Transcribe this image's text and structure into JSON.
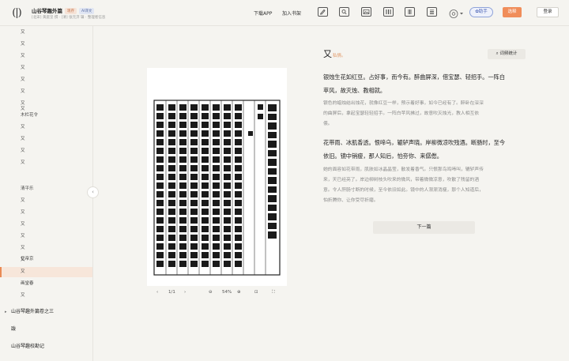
{
  "header": {
    "logo": "(|)",
    "book_title": "山谷琴趣外篇",
    "badge_primary": "现存",
    "badge_secondary": "AI译文",
    "book_meta": "[北宋] 黄庭坚 撰  ·  [清] 张元济 辑  ·  整理者信息",
    "download_app": "下载APP",
    "add_shelf": "加入书架",
    "help_label": "助手",
    "hide_label": "选释",
    "login_label": "登录"
  },
  "sidebar": {
    "items": [
      {
        "label": "又"
      },
      {
        "label": "又"
      },
      {
        "label": "又"
      },
      {
        "label": "又"
      },
      {
        "label": "又"
      },
      {
        "label": "又"
      },
      {
        "label": "又"
      },
      {
        "label": "又"
      },
      {
        "label": "木栏花令"
      },
      {
        "label": "又"
      },
      {
        "label": "又"
      },
      {
        "label": "又"
      },
      {
        "label": "又"
      },
      {
        "label": "清平乐"
      },
      {
        "label": "又"
      },
      {
        "label": "又"
      },
      {
        "label": "又"
      },
      {
        "label": "又"
      },
      {
        "label": "又"
      },
      {
        "label": "又"
      },
      {
        "label": "忆帝京"
      },
      {
        "label": "又"
      },
      {
        "label": "画堂春"
      },
      {
        "label": "又"
      }
    ],
    "sections": [
      {
        "label": "山谷琴趣外篇卷之三"
      },
      {
        "label": "跋"
      },
      {
        "label": "山谷琴趣校勘记"
      }
    ]
  },
  "viewer": {
    "page": "1/1",
    "zoom": "54%"
  },
  "poem": {
    "title": "又",
    "subtitle": "私情。",
    "stats_label": "词频统计",
    "stanzas": [
      {
        "original": [
          "银烛生花如红豆。占好事，而今有。醉曲屏深，借宝瑟、轻招手。一阵白",
          "苹风，故灭烛、教相就。"
        ],
        "translation": [
          "银色的蜡烛结出烛花，就像红豆一样，预示着好事，如今已经有了。醉卧在深深",
          "的曲屏后，拿起宝瑟轻轻招手。一阵白苹风拂过，故意吹灭烛光，教人相互依",
          "偎。"
        ]
      },
      {
        "original": [
          "花带雨、冰肌香透。恨啼乌，辘轳声晓。岸柳微凉吹残酒。断肠时，至今",
          "依旧。镜中销瘦，那人知后，怕夯你、来僝僽。"
        ],
        "translation": [
          "她的面容如花带雨，肌肤如冰晶晶莹，散发着香气。只恨那鸟鸣啼叫，辘轳声传",
          "来，天已经亮了。岸边柳树枝头吹来的微风，带着微微凉意，吹散了残留的酒",
          "意。令人肝肠寸断的时候，至今依旧如此。镜中的人渐渐消瘦，那个人知道后，",
          "怕折腾你、让你受尽折磨。"
        ]
      }
    ],
    "next_label": "下一篇"
  }
}
